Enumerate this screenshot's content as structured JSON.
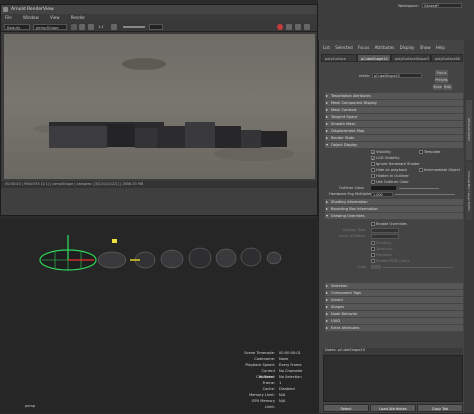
{
  "workspace": {
    "label": "Workspace:",
    "value": "General*"
  },
  "render_view": {
    "title": "Arnold RenderView",
    "menu": [
      "File",
      "Window",
      "View",
      "Render"
    ],
    "toolbar": {
      "display": "Beauty",
      "camera": "perspShape",
      "zoom": "1:1"
    },
    "status": "00:00:04 | 960x533 (1:1) | perspShape | samples: [3/2/2/2/2/2/2] | 2656.53 MB"
  },
  "attribute_editor": {
    "menu": [
      "List",
      "Selected",
      "Focus",
      "Attributes",
      "Display",
      "Show",
      "Help"
    ],
    "tabs": [
      "polySurface",
      "pCubeShape10",
      "polySurfaceShape3",
      "polySurfaceSh"
    ],
    "mesh_label": "mesh:",
    "mesh_value": "pCubeShape10",
    "buttons": {
      "focus": "Focus",
      "presets": "Presets",
      "show": "Show",
      "hide": "Hide"
    },
    "sections": [
      "Tessellation Attributes",
      "Mesh Component Display",
      "Mesh Controls",
      "Tangent Space",
      "Smooth Mesh",
      "Displacement Map",
      "Render Stats",
      "Object Display",
      "Shading Information",
      "Bounding Box Information",
      "Drawing Overrides",
      "Selection",
      "Component Tags",
      "Arnold",
      "Shapes",
      "Node Behavior",
      "UUID",
      "Extra Attributes"
    ],
    "object_display": {
      "visibility": "Visibility",
      "template": "Template",
      "lod_visibility": "LOD Visibility",
      "ignore_hw_shader": "Ignore Hardware Shader",
      "hide_on_playback": "Hide on playback",
      "intermediate_object": "Intermediate Object",
      "hidden_in_outliner": "Hidden In Outliner",
      "use_outliner_color": "Use Outliner Color",
      "outliner_color": "Outliner Color",
      "hw_fog_multiplier": "Hardware Fog Multiplier",
      "hw_fog_value": "1.000"
    },
    "drawing_overrides": {
      "enable_overrides": "Enable Overrides",
      "display_type": "Display Type",
      "level_of_detail": "Level of Detail",
      "shading": "Shading",
      "texturing": "Texturing",
      "playback": "Playback",
      "enable_rgb": "Enable RGB Colors",
      "color": "Color"
    },
    "notes_label": "Notes:  pCubeShape10",
    "bottom_buttons": {
      "select": "Select",
      "load": "Load Attributes",
      "copy": "Copy Tab"
    }
  },
  "side_tabs": [
    "Attribute Editor",
    "Channel Box / Layer Editor"
  ],
  "hud": [
    {
      "k": "Scene Timecode:",
      "v": "00:00:00:01"
    },
    {
      "k": "Codename:",
      "v": "None"
    },
    {
      "k": "Playback Speed:",
      "v": "Every Frame"
    },
    {
      "k": "Current Character:",
      "v": "No Character"
    },
    {
      "k": "IK Blend:",
      "v": "No Selection"
    },
    {
      "k": "Frame:",
      "v": "1"
    },
    {
      "k": "Cache:",
      "v": "Disabled"
    },
    {
      "k": "Memory Limit:",
      "v": "N/A"
    },
    {
      "k": "GPU Memory Limit:",
      "v": "N/A"
    }
  ],
  "viewport": {
    "camera_label": "persp"
  }
}
